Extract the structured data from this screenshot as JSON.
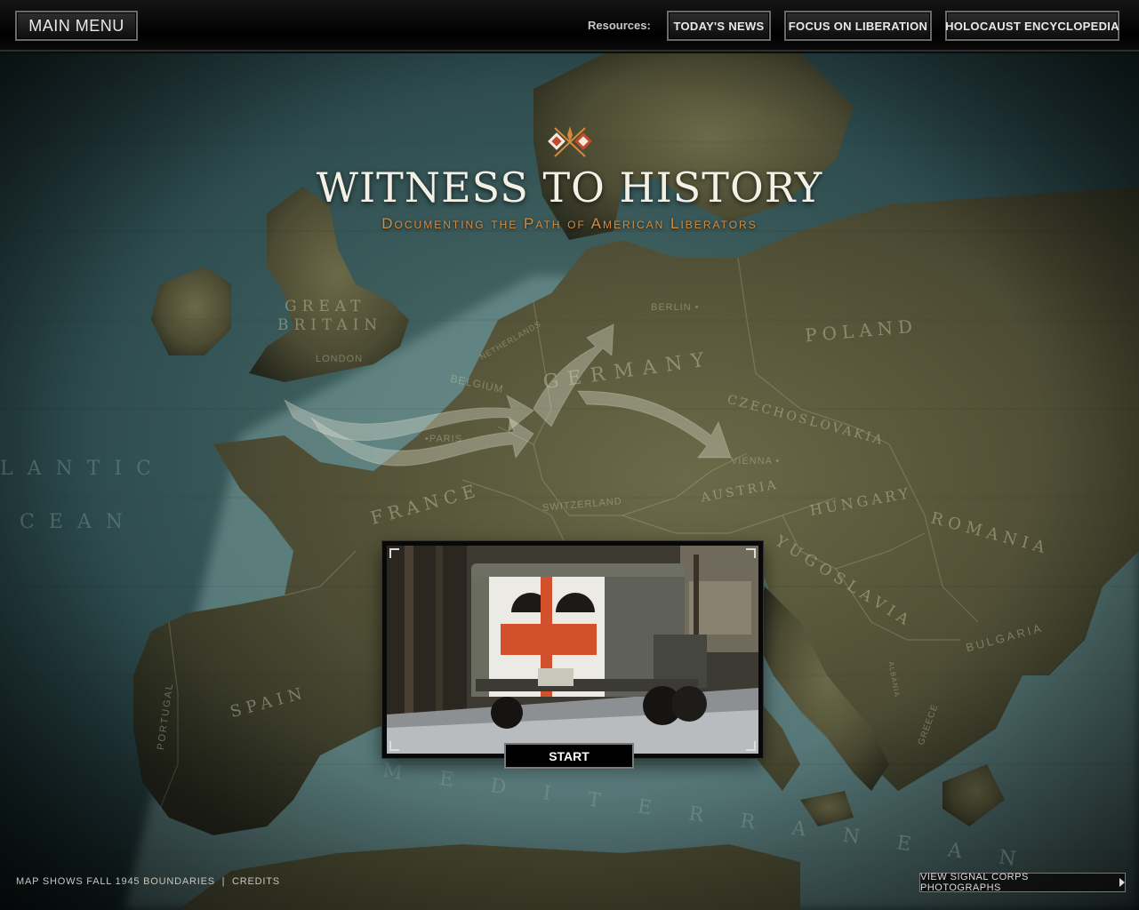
{
  "header": {
    "main_menu_label": "MAIN MENU",
    "resources_label": "Resources:",
    "resources": [
      {
        "label": "TODAY'S NEWS"
      },
      {
        "label": "FOCUS ON LIBERATION"
      },
      {
        "label": "HOLOCAUST ENCYCLOPEDIA"
      }
    ]
  },
  "title": "WITNESS TO HISTORY",
  "subtitle": "Documenting the Path of American Liberators",
  "map": {
    "countries": {
      "great_britain_1": "GREAT",
      "great_britain_2": "BRITAIN",
      "france": "FRANCE",
      "germany": "GERMANY",
      "poland": "POLAND",
      "czechoslovakia": "CZECHOSLOVAKIA",
      "hungary": "HUNGARY",
      "romania": "ROMANIA",
      "yugoslavia": "YUGOSLAVIA",
      "austria": "AUSTRIA",
      "spain": "SPAIN",
      "portugal": "PORTUGAL",
      "belgium": "BELGIUM",
      "netherlands": "NETHERLANDS",
      "switzerland": "SWITZERLAND",
      "bulgaria": "BULGARIA",
      "greece": "GREECE",
      "albania": "ALBANIA"
    },
    "cities": {
      "london": "LONDON",
      "paris": "•PARIS",
      "berlin": "BERLIN •",
      "vienna": "VIENNA •"
    },
    "seas": {
      "atlantic_1": "LANTIC",
      "atlantic_2": "CEAN",
      "mediterranean": "MEDITERRANEAN"
    }
  },
  "video": {
    "start_label": "START"
  },
  "footer": {
    "boundaries_note": "MAP SHOWS FALL 1945 BOUNDARIES",
    "separator": "|",
    "credits_label": "CREDITS",
    "signal_corps_label": "VIEW SIGNAL CORPS PHOTOGRAPHS"
  },
  "colors": {
    "accent": "#d68a3c",
    "title": "#f3f1e6",
    "land": "#55533a",
    "sea": "#355a5c"
  }
}
